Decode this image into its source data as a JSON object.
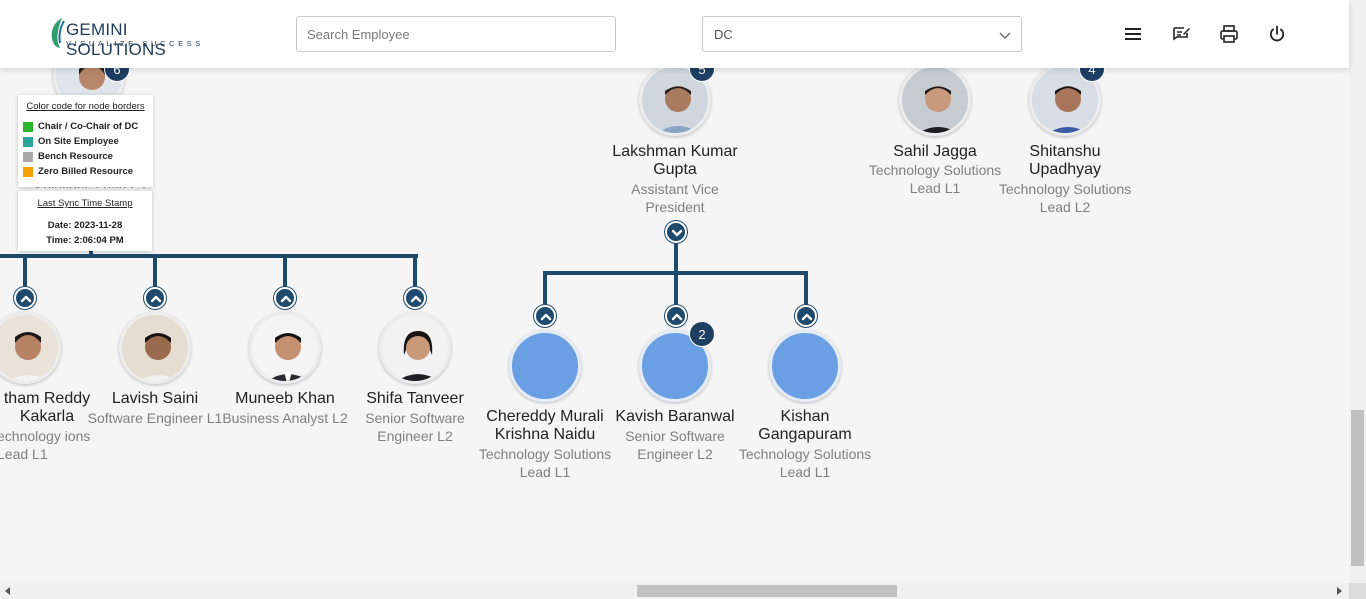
{
  "header": {
    "logo": {
      "brand": "GEMINI SOLUTIONS",
      "tagline": "VISUALIZE SUCCESS"
    },
    "search": {
      "placeholder": "Search Employee",
      "value": ""
    },
    "dc_select": {
      "value": "DC"
    },
    "actions": [
      "menu-icon",
      "feedback-icon",
      "print-icon",
      "power-icon"
    ]
  },
  "colors": {
    "accent": "#1e4a6d",
    "chair": "#2db52d",
    "onsite": "#2ba39b",
    "bench": "#a8a8a8",
    "zero_billed": "#f5a300",
    "placeholder_avatar": "#6a9fe4"
  },
  "legend": {
    "title": "Color code for node borders",
    "items": [
      {
        "label": "Chair / Co-Chair of DC"
      },
      {
        "label": "On Site Employee"
      },
      {
        "label": "Bench Resource"
      },
      {
        "label": "Zero Billed Resource"
      }
    ]
  },
  "sync": {
    "title": "Last Sync Time Stamp",
    "date": "Date: 2023-11-28",
    "time": "Time: 2:06:04 PM"
  },
  "nodes": {
    "top_left": {
      "badge": "6",
      "role_fragment": "Solutions Lead L2"
    },
    "lakshman": {
      "name": "Lakshman Kumar Gupta",
      "role": "Assistant Vice President",
      "badge": "5"
    },
    "sahil": {
      "name": "Sahil Jagga",
      "role": "Technology Solutions Lead L1"
    },
    "shitanshu": {
      "name": "Shitanshu Upadhyay",
      "role": "Technology Solutions Lead L2",
      "badge": "4"
    },
    "hitham": {
      "name": "tham Reddy Kakarla",
      "role": "echnology ions Lead L1"
    },
    "lavish": {
      "name": "Lavish Saini",
      "role": "Software Engineer L1"
    },
    "muneeb": {
      "name": "Muneeb Khan",
      "role": "Business Analyst L2"
    },
    "shifa": {
      "name": "Shifa Tanveer",
      "role": "Senior Software Engineer L2"
    },
    "chereddy": {
      "name": "Chereddy Murali Krishna Naidu",
      "role": "Technology Solutions Lead L1"
    },
    "kavish": {
      "name": "Kavish Baranwal",
      "role": "Senior Software Engineer L2",
      "badge": "2"
    },
    "kishan": {
      "name": "Kishan Gangapuram",
      "role": "Technology Solutions Lead L1"
    }
  }
}
